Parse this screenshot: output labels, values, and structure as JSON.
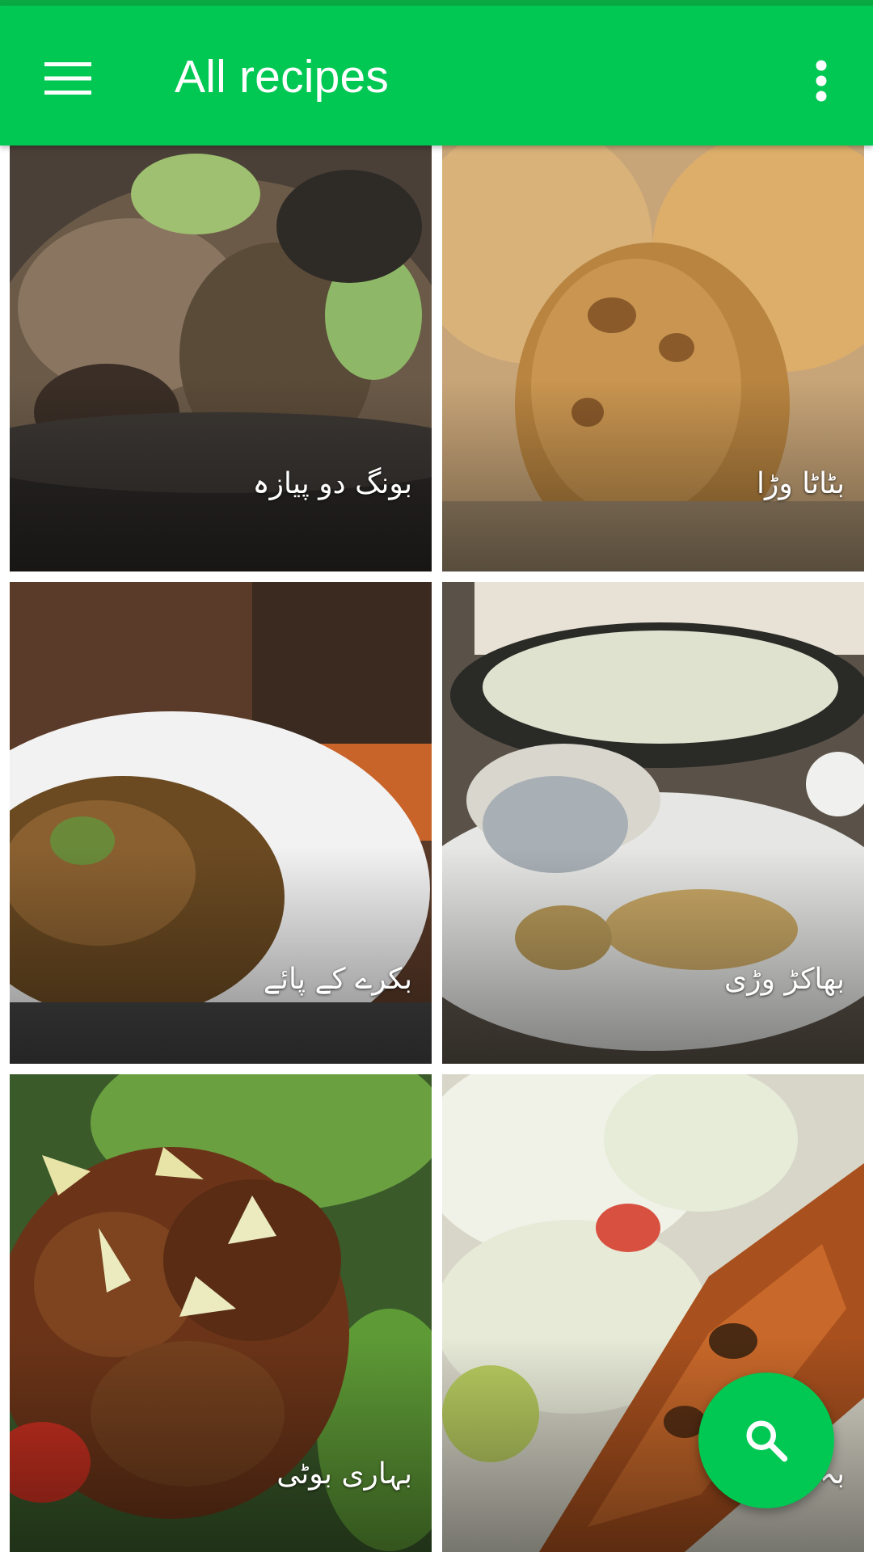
{
  "app_bar": {
    "title": "All recipes",
    "menu_icon": "hamburger-menu-icon",
    "overflow_icon": "more-vert-icon",
    "color": "#00c853"
  },
  "recipes": [
    {
      "name": "بونگ دو پیازہ"
    },
    {
      "name": "بٹاٹا وڑا"
    },
    {
      "name": "بکرے کے پائے"
    },
    {
      "name": "بھاکڑ وڑی"
    },
    {
      "name": "بہاری بوٹی"
    },
    {
      "name": "بہ"
    }
  ],
  "fab": {
    "icon": "search-icon",
    "color": "#00c853"
  }
}
